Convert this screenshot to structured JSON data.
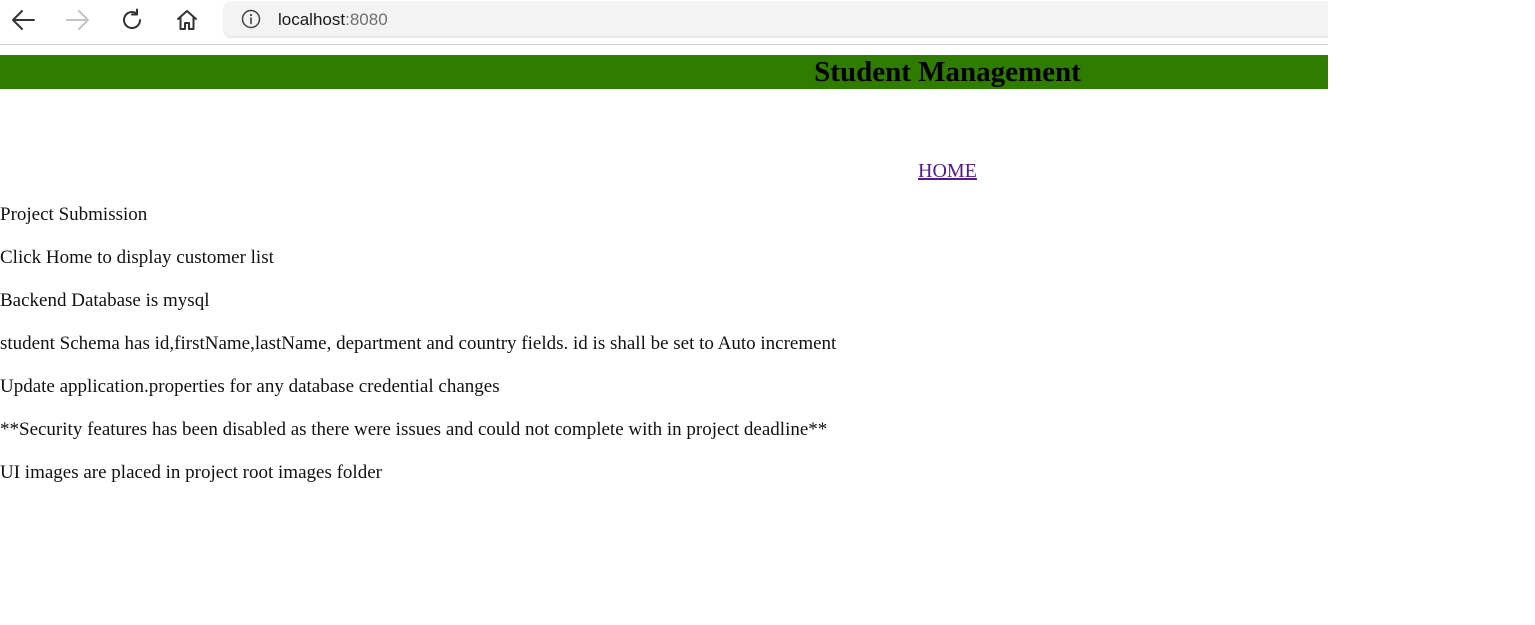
{
  "browser": {
    "url_host": "localhost",
    "url_port": ":8080",
    "icons": {
      "back": "arrow-left-icon",
      "forward": "arrow-right-icon",
      "reload": "reload-icon",
      "home": "home-icon",
      "info": "info-icon"
    }
  },
  "header": {
    "title": "Student Management",
    "background_color": "#2e7d00"
  },
  "nav": {
    "home_label": "HOME",
    "link_color": "#551a8b"
  },
  "content": {
    "lines": [
      "Project Submission",
      "Click Home to display customer list",
      "Backend Database is mysql",
      "student Schema has id,firstName,lastName, department and country fields. id is shall be set to Auto increment",
      "Update application.properties for any database credential changes",
      "**Security features has been disabled as there were issues and could not complete with in project deadline**",
      "UI images are placed in project root images folder"
    ]
  }
}
